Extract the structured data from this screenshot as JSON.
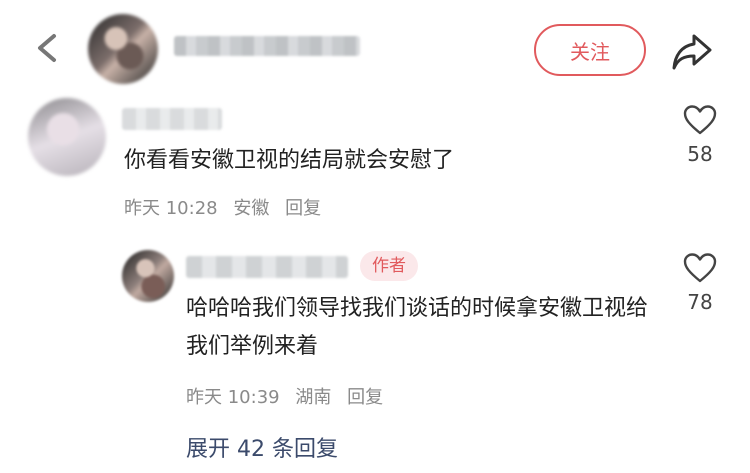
{
  "header": {
    "follow_label": "关注"
  },
  "comments": [
    {
      "text": "你看看安徽卫视的结局就会安慰了",
      "time": "昨天 10:28",
      "location": "安徽",
      "reply_label": "回复",
      "likes": "58"
    }
  ],
  "reply": {
    "author_badge": "作者",
    "text": "哈哈哈我们领导找我们谈话的时候拿安徽卫视给我们举例来着",
    "time": "昨天 10:39",
    "location": "湖南",
    "reply_label": "回复",
    "likes": "78"
  },
  "expand_label": "展开 42 条回复",
  "colors": {
    "accent": "#e15a5d",
    "badge_bg": "#fbe8ea",
    "link": "#3b4a6b",
    "meta": "#8a8a8a"
  },
  "icons": {
    "back": "back-arrow-icon",
    "share": "share-icon",
    "like": "heart-icon"
  }
}
